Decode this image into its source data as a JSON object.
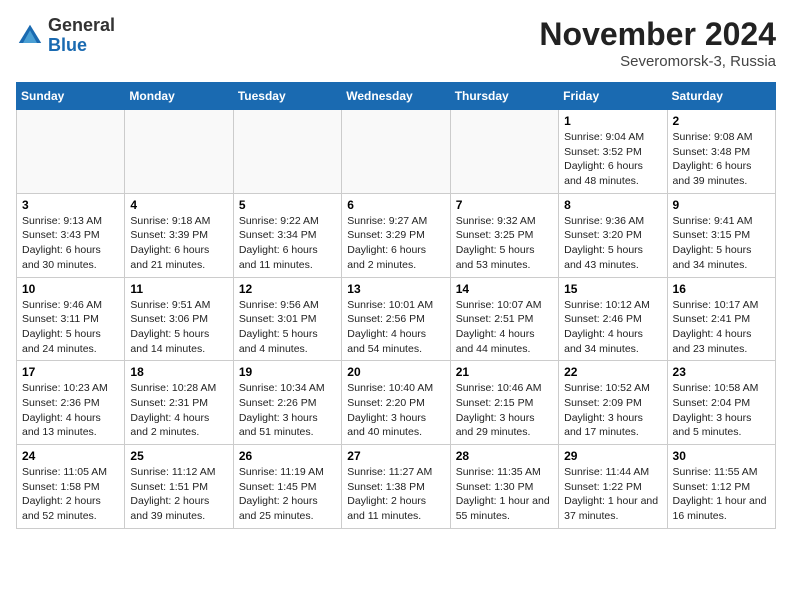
{
  "logo": {
    "general": "General",
    "blue": "Blue"
  },
  "title": "November 2024",
  "location": "Severomorsk-3, Russia",
  "days_header": [
    "Sunday",
    "Monday",
    "Tuesday",
    "Wednesday",
    "Thursday",
    "Friday",
    "Saturday"
  ],
  "weeks": [
    [
      {
        "day": "",
        "info": ""
      },
      {
        "day": "",
        "info": ""
      },
      {
        "day": "",
        "info": ""
      },
      {
        "day": "",
        "info": ""
      },
      {
        "day": "",
        "info": ""
      },
      {
        "day": "1",
        "info": "Sunrise: 9:04 AM\nSunset: 3:52 PM\nDaylight: 6 hours and 48 minutes."
      },
      {
        "day": "2",
        "info": "Sunrise: 9:08 AM\nSunset: 3:48 PM\nDaylight: 6 hours and 39 minutes."
      }
    ],
    [
      {
        "day": "3",
        "info": "Sunrise: 9:13 AM\nSunset: 3:43 PM\nDaylight: 6 hours and 30 minutes."
      },
      {
        "day": "4",
        "info": "Sunrise: 9:18 AM\nSunset: 3:39 PM\nDaylight: 6 hours and 21 minutes."
      },
      {
        "day": "5",
        "info": "Sunrise: 9:22 AM\nSunset: 3:34 PM\nDaylight: 6 hours and 11 minutes."
      },
      {
        "day": "6",
        "info": "Sunrise: 9:27 AM\nSunset: 3:29 PM\nDaylight: 6 hours and 2 minutes."
      },
      {
        "day": "7",
        "info": "Sunrise: 9:32 AM\nSunset: 3:25 PM\nDaylight: 5 hours and 53 minutes."
      },
      {
        "day": "8",
        "info": "Sunrise: 9:36 AM\nSunset: 3:20 PM\nDaylight: 5 hours and 43 minutes."
      },
      {
        "day": "9",
        "info": "Sunrise: 9:41 AM\nSunset: 3:15 PM\nDaylight: 5 hours and 34 minutes."
      }
    ],
    [
      {
        "day": "10",
        "info": "Sunrise: 9:46 AM\nSunset: 3:11 PM\nDaylight: 5 hours and 24 minutes."
      },
      {
        "day": "11",
        "info": "Sunrise: 9:51 AM\nSunset: 3:06 PM\nDaylight: 5 hours and 14 minutes."
      },
      {
        "day": "12",
        "info": "Sunrise: 9:56 AM\nSunset: 3:01 PM\nDaylight: 5 hours and 4 minutes."
      },
      {
        "day": "13",
        "info": "Sunrise: 10:01 AM\nSunset: 2:56 PM\nDaylight: 4 hours and 54 minutes."
      },
      {
        "day": "14",
        "info": "Sunrise: 10:07 AM\nSunset: 2:51 PM\nDaylight: 4 hours and 44 minutes."
      },
      {
        "day": "15",
        "info": "Sunrise: 10:12 AM\nSunset: 2:46 PM\nDaylight: 4 hours and 34 minutes."
      },
      {
        "day": "16",
        "info": "Sunrise: 10:17 AM\nSunset: 2:41 PM\nDaylight: 4 hours and 23 minutes."
      }
    ],
    [
      {
        "day": "17",
        "info": "Sunrise: 10:23 AM\nSunset: 2:36 PM\nDaylight: 4 hours and 13 minutes."
      },
      {
        "day": "18",
        "info": "Sunrise: 10:28 AM\nSunset: 2:31 PM\nDaylight: 4 hours and 2 minutes."
      },
      {
        "day": "19",
        "info": "Sunrise: 10:34 AM\nSunset: 2:26 PM\nDaylight: 3 hours and 51 minutes."
      },
      {
        "day": "20",
        "info": "Sunrise: 10:40 AM\nSunset: 2:20 PM\nDaylight: 3 hours and 40 minutes."
      },
      {
        "day": "21",
        "info": "Sunrise: 10:46 AM\nSunset: 2:15 PM\nDaylight: 3 hours and 29 minutes."
      },
      {
        "day": "22",
        "info": "Sunrise: 10:52 AM\nSunset: 2:09 PM\nDaylight: 3 hours and 17 minutes."
      },
      {
        "day": "23",
        "info": "Sunrise: 10:58 AM\nSunset: 2:04 PM\nDaylight: 3 hours and 5 minutes."
      }
    ],
    [
      {
        "day": "24",
        "info": "Sunrise: 11:05 AM\nSunset: 1:58 PM\nDaylight: 2 hours and 52 minutes."
      },
      {
        "day": "25",
        "info": "Sunrise: 11:12 AM\nSunset: 1:51 PM\nDaylight: 2 hours and 39 minutes."
      },
      {
        "day": "26",
        "info": "Sunrise: 11:19 AM\nSunset: 1:45 PM\nDaylight: 2 hours and 25 minutes."
      },
      {
        "day": "27",
        "info": "Sunrise: 11:27 AM\nSunset: 1:38 PM\nDaylight: 2 hours and 11 minutes."
      },
      {
        "day": "28",
        "info": "Sunrise: 11:35 AM\nSunset: 1:30 PM\nDaylight: 1 hour and 55 minutes."
      },
      {
        "day": "29",
        "info": "Sunrise: 11:44 AM\nSunset: 1:22 PM\nDaylight: 1 hour and 37 minutes."
      },
      {
        "day": "30",
        "info": "Sunrise: 11:55 AM\nSunset: 1:12 PM\nDaylight: 1 hour and 16 minutes."
      }
    ]
  ]
}
